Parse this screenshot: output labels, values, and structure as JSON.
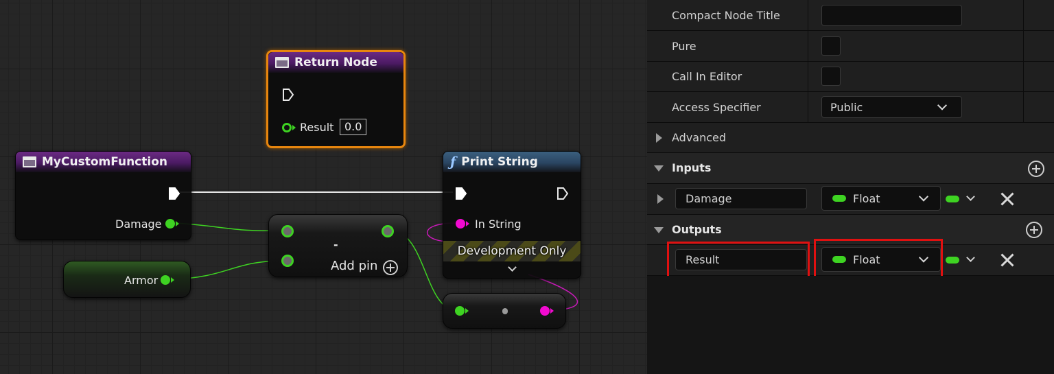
{
  "graph": {
    "return_node": {
      "title": "Return Node",
      "result_label": "Result",
      "result_value": "0.0"
    },
    "custom_function_node": {
      "title": "MyCustomFunction",
      "damage_label": "Damage"
    },
    "armor_node": {
      "label": "Armor"
    },
    "add_node": {
      "symbol": "-",
      "add_pin_label": "Add pin"
    },
    "print_string_node": {
      "title": "Print String",
      "in_string_label": "In String",
      "dev_only_label": "Development Only"
    },
    "colors": {
      "exec_wire": "#e8e8e8",
      "float_wire": "#3ed322",
      "string_wire": "#c81ab8"
    }
  },
  "details": {
    "compact_node_title": {
      "label": "Compact Node Title",
      "value": ""
    },
    "pure": {
      "label": "Pure"
    },
    "call_in_editor": {
      "label": "Call In Editor"
    },
    "access_specifier": {
      "label": "Access Specifier",
      "value": "Public"
    },
    "advanced": {
      "label": "Advanced"
    },
    "inputs": {
      "label": "Inputs",
      "items": [
        {
          "name": "Damage",
          "type": "Float"
        }
      ]
    },
    "outputs": {
      "label": "Outputs",
      "items": [
        {
          "name": "Result",
          "type": "Float"
        }
      ]
    },
    "icons": [
      "plus-circle-icon",
      "close-icon",
      "chevron-down-icon",
      "expand-arrow-icon"
    ]
  }
}
